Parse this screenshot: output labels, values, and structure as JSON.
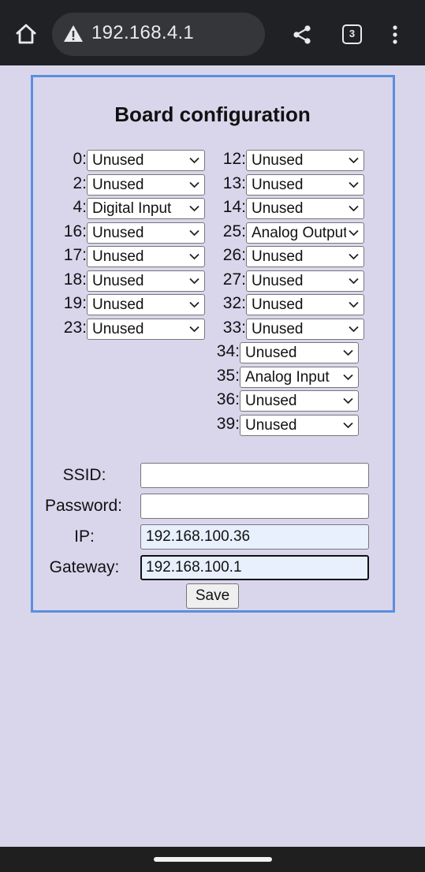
{
  "browser": {
    "url": "192.168.4.1",
    "tab_count": "3",
    "icons": [
      "home-icon",
      "warning-icon",
      "share-icon",
      "tab-switcher-icon",
      "more-vert-icon"
    ]
  },
  "page": {
    "title": "Board configuration",
    "pins_left": [
      {
        "label": "0:",
        "value": "Unused"
      },
      {
        "label": "2:",
        "value": "Unused"
      },
      {
        "label": "4:",
        "value": "Digital Input"
      },
      {
        "label": "16:",
        "value": "Unused"
      },
      {
        "label": "17:",
        "value": "Unused"
      },
      {
        "label": "18:",
        "value": "Unused"
      },
      {
        "label": "19:",
        "value": "Unused"
      },
      {
        "label": "23:",
        "value": "Unused"
      }
    ],
    "pins_right": [
      {
        "label": "12:",
        "value": "Unused"
      },
      {
        "label": "13:",
        "value": "Unused"
      },
      {
        "label": "14:",
        "value": "Unused"
      },
      {
        "label": "25:",
        "value": "Analog Output"
      },
      {
        "label": "26:",
        "value": "Unused"
      },
      {
        "label": "27:",
        "value": "Unused"
      },
      {
        "label": "32:",
        "value": "Unused"
      },
      {
        "label": "33:",
        "value": "Unused"
      }
    ],
    "pins_extra": [
      {
        "label": "34:",
        "value": "Unused"
      },
      {
        "label": "35:",
        "value": "Analog Input"
      },
      {
        "label": "36:",
        "value": "Unused"
      },
      {
        "label": "39:",
        "value": "Unused"
      }
    ],
    "form": {
      "ssid_label": "SSID:",
      "ssid_value": "",
      "password_label": "Password:",
      "password_value": "",
      "ip_label": "IP:",
      "ip_value": "192.168.100.36",
      "gateway_label": "Gateway:",
      "gateway_value": "192.168.100.1",
      "save_label": "Save"
    }
  },
  "colors": {
    "page_background": "#d9d6ec",
    "frame_border": "#5b8ede",
    "chrome_background": "#202124",
    "autofill_background": "#e8f0fe"
  }
}
